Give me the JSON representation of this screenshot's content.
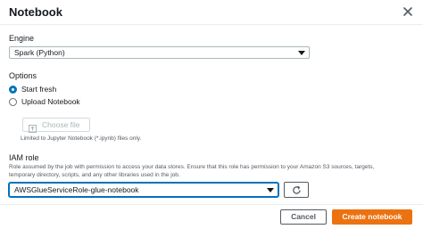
{
  "dialog": {
    "title": "Notebook",
    "close_icon": "close-icon"
  },
  "engine": {
    "label": "Engine",
    "selected": "Spark (Python)",
    "caret_icon": "caret-down-icon"
  },
  "options": {
    "label": "Options",
    "items": [
      {
        "label": "Start fresh",
        "selected": true
      },
      {
        "label": "Upload Notebook",
        "selected": false
      }
    ],
    "choose_file": {
      "label": "Choose file",
      "icon": "upload-icon",
      "enabled": false
    },
    "help": "Limited to Jupyter Notebook (*.ipynb) files only."
  },
  "iam_role": {
    "label": "IAM role",
    "help_line_1": "Role assumed by the job with permission to access your data stores. Ensure that this role has permission to your Amazon S3 sources, targets,",
    "help_line_2": "temporary directory, scripts, and any other libraries used in the job.",
    "selected": "AWSGlueServiceRole-glue-notebook",
    "refresh_icon": "refresh-icon"
  },
  "footer": {
    "cancel_label": "Cancel",
    "create_label": "Create notebook"
  },
  "colors": {
    "primary": "#ec7211",
    "focus": "#0073bb",
    "text": "#16191f",
    "muted": "#545b64"
  }
}
